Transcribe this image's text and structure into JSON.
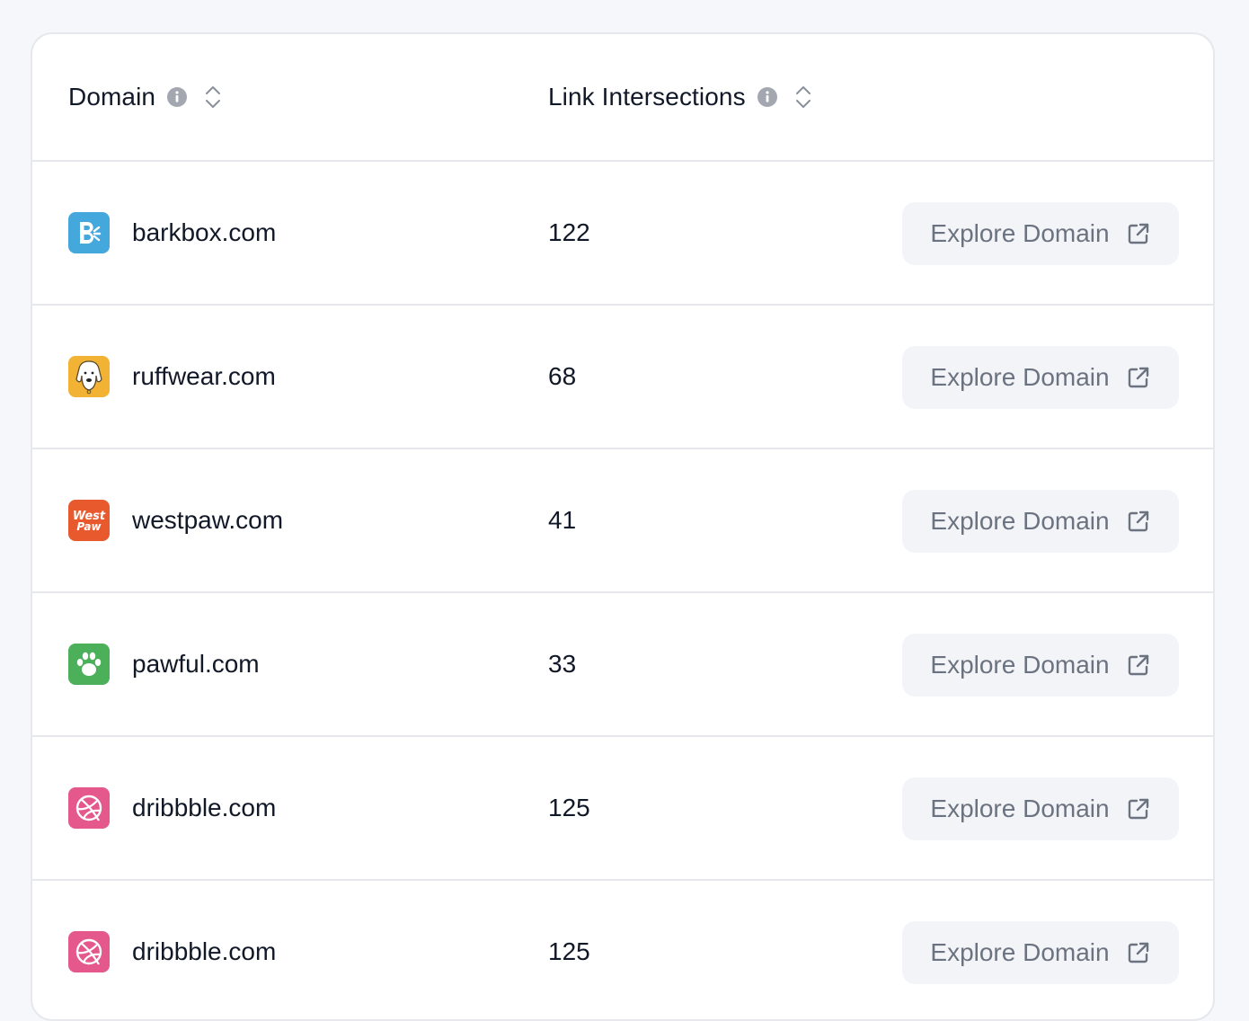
{
  "table": {
    "columns": {
      "domain": "Domain",
      "link_intersections": "Link Intersections"
    },
    "rows": [
      {
        "domain": "barkbox.com",
        "links": "122",
        "button": "Explore Domain",
        "favicon": "barkbox-logo-icon",
        "color": "#45a8dc"
      },
      {
        "domain": "ruffwear.com",
        "links": "68",
        "button": "Explore Domain",
        "favicon": "ruffwear-dog-logo-icon",
        "color": "#f2b233"
      },
      {
        "domain": "westpaw.com",
        "links": "41",
        "button": "Explore Domain",
        "favicon": "westpaw-logo-icon",
        "color": "#e85a2e"
      },
      {
        "domain": "pawful.com",
        "links": "33",
        "button": "Explore Domain",
        "favicon": "paw-print-icon",
        "color": "#4caf5a"
      },
      {
        "domain": "dribbble.com",
        "links": "125",
        "button": "Explore Domain",
        "favicon": "dribbble-ball-icon",
        "color": "#e5588c"
      },
      {
        "domain": "dribbble.com",
        "links": "125",
        "button": "Explore Domain",
        "favicon": "dribbble-ball-icon",
        "color": "#e5588c"
      }
    ]
  },
  "theme": {
    "page_background": "#f6f7fa",
    "border": "#e6e8ee",
    "button_background": "#f3f4f8",
    "button_text": "#6b7280",
    "icon_gray": "#a3a7b0"
  },
  "favicon_text": {
    "westpaw": [
      "West",
      "Paw"
    ]
  }
}
